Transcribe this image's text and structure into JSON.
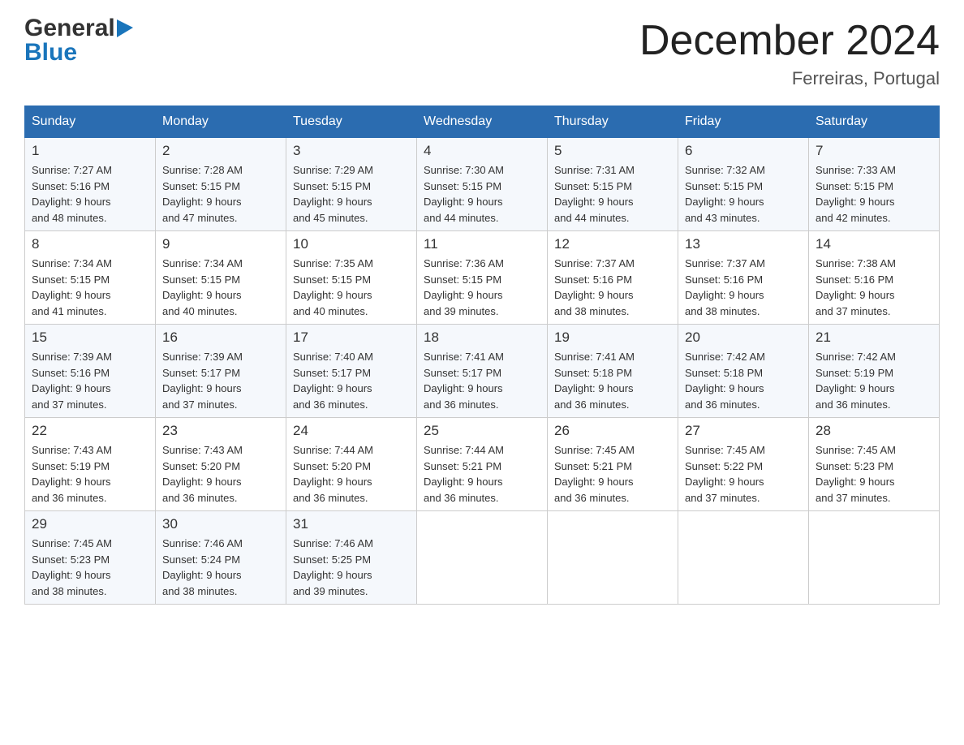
{
  "header": {
    "logo_general": "General",
    "logo_blue": "Blue",
    "month_title": "December 2024",
    "location": "Ferreiras, Portugal"
  },
  "days_of_week": [
    "Sunday",
    "Monday",
    "Tuesday",
    "Wednesday",
    "Thursday",
    "Friday",
    "Saturday"
  ],
  "weeks": [
    [
      {
        "num": "1",
        "sunrise": "7:27 AM",
        "sunset": "5:16 PM",
        "daylight": "9 hours and 48 minutes."
      },
      {
        "num": "2",
        "sunrise": "7:28 AM",
        "sunset": "5:15 PM",
        "daylight": "9 hours and 47 minutes."
      },
      {
        "num": "3",
        "sunrise": "7:29 AM",
        "sunset": "5:15 PM",
        "daylight": "9 hours and 45 minutes."
      },
      {
        "num": "4",
        "sunrise": "7:30 AM",
        "sunset": "5:15 PM",
        "daylight": "9 hours and 44 minutes."
      },
      {
        "num": "5",
        "sunrise": "7:31 AM",
        "sunset": "5:15 PM",
        "daylight": "9 hours and 44 minutes."
      },
      {
        "num": "6",
        "sunrise": "7:32 AM",
        "sunset": "5:15 PM",
        "daylight": "9 hours and 43 minutes."
      },
      {
        "num": "7",
        "sunrise": "7:33 AM",
        "sunset": "5:15 PM",
        "daylight": "9 hours and 42 minutes."
      }
    ],
    [
      {
        "num": "8",
        "sunrise": "7:34 AM",
        "sunset": "5:15 PM",
        "daylight": "9 hours and 41 minutes."
      },
      {
        "num": "9",
        "sunrise": "7:34 AM",
        "sunset": "5:15 PM",
        "daylight": "9 hours and 40 minutes."
      },
      {
        "num": "10",
        "sunrise": "7:35 AM",
        "sunset": "5:15 PM",
        "daylight": "9 hours and 40 minutes."
      },
      {
        "num": "11",
        "sunrise": "7:36 AM",
        "sunset": "5:15 PM",
        "daylight": "9 hours and 39 minutes."
      },
      {
        "num": "12",
        "sunrise": "7:37 AM",
        "sunset": "5:16 PM",
        "daylight": "9 hours and 38 minutes."
      },
      {
        "num": "13",
        "sunrise": "7:37 AM",
        "sunset": "5:16 PM",
        "daylight": "9 hours and 38 minutes."
      },
      {
        "num": "14",
        "sunrise": "7:38 AM",
        "sunset": "5:16 PM",
        "daylight": "9 hours and 37 minutes."
      }
    ],
    [
      {
        "num": "15",
        "sunrise": "7:39 AM",
        "sunset": "5:16 PM",
        "daylight": "9 hours and 37 minutes."
      },
      {
        "num": "16",
        "sunrise": "7:39 AM",
        "sunset": "5:17 PM",
        "daylight": "9 hours and 37 minutes."
      },
      {
        "num": "17",
        "sunrise": "7:40 AM",
        "sunset": "5:17 PM",
        "daylight": "9 hours and 36 minutes."
      },
      {
        "num": "18",
        "sunrise": "7:41 AM",
        "sunset": "5:17 PM",
        "daylight": "9 hours and 36 minutes."
      },
      {
        "num": "19",
        "sunrise": "7:41 AM",
        "sunset": "5:18 PM",
        "daylight": "9 hours and 36 minutes."
      },
      {
        "num": "20",
        "sunrise": "7:42 AM",
        "sunset": "5:18 PM",
        "daylight": "9 hours and 36 minutes."
      },
      {
        "num": "21",
        "sunrise": "7:42 AM",
        "sunset": "5:19 PM",
        "daylight": "9 hours and 36 minutes."
      }
    ],
    [
      {
        "num": "22",
        "sunrise": "7:43 AM",
        "sunset": "5:19 PM",
        "daylight": "9 hours and 36 minutes."
      },
      {
        "num": "23",
        "sunrise": "7:43 AM",
        "sunset": "5:20 PM",
        "daylight": "9 hours and 36 minutes."
      },
      {
        "num": "24",
        "sunrise": "7:44 AM",
        "sunset": "5:20 PM",
        "daylight": "9 hours and 36 minutes."
      },
      {
        "num": "25",
        "sunrise": "7:44 AM",
        "sunset": "5:21 PM",
        "daylight": "9 hours and 36 minutes."
      },
      {
        "num": "26",
        "sunrise": "7:45 AM",
        "sunset": "5:21 PM",
        "daylight": "9 hours and 36 minutes."
      },
      {
        "num": "27",
        "sunrise": "7:45 AM",
        "sunset": "5:22 PM",
        "daylight": "9 hours and 37 minutes."
      },
      {
        "num": "28",
        "sunrise": "7:45 AM",
        "sunset": "5:23 PM",
        "daylight": "9 hours and 37 minutes."
      }
    ],
    [
      {
        "num": "29",
        "sunrise": "7:45 AM",
        "sunset": "5:23 PM",
        "daylight": "9 hours and 38 minutes."
      },
      {
        "num": "30",
        "sunrise": "7:46 AM",
        "sunset": "5:24 PM",
        "daylight": "9 hours and 38 minutes."
      },
      {
        "num": "31",
        "sunrise": "7:46 AM",
        "sunset": "5:25 PM",
        "daylight": "9 hours and 39 minutes."
      },
      null,
      null,
      null,
      null
    ]
  ],
  "labels": {
    "sunrise": "Sunrise:",
    "sunset": "Sunset:",
    "daylight": "Daylight:"
  }
}
